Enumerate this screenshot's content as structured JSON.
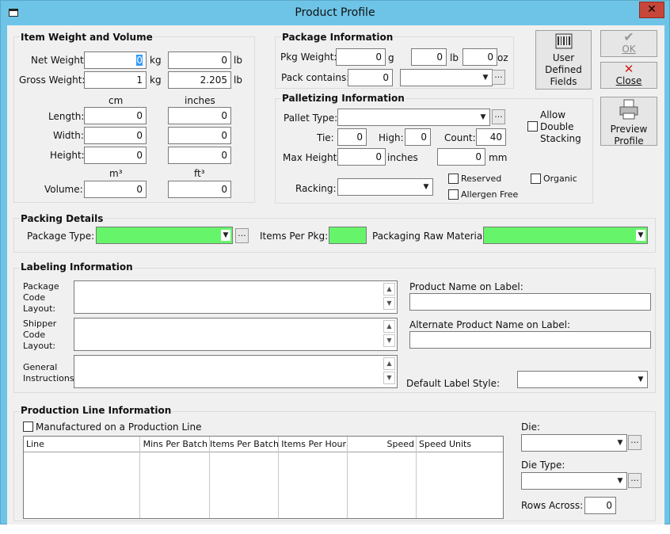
{
  "window": {
    "title": "Product Profile",
    "close_glyph": "✕"
  },
  "weight_volume": {
    "title": "Item Weight and Volume",
    "net_weight_label": "Net Weight:",
    "net_weight_kg": "0",
    "kg1": "kg",
    "net_weight_lb": "0",
    "lb1": "lb",
    "gross_weight_label": "Gross Weight:",
    "gross_weight_kg": "1",
    "kg2": "kg",
    "gross_weight_lb": "2.205",
    "lb2": "lb",
    "cm_label": "cm",
    "inches_label": "inches",
    "length_label": "Length:",
    "length_cm": "0",
    "length_in": "0",
    "width_label": "Width:",
    "width_cm": "0",
    "width_in": "0",
    "height_label": "Height:",
    "height_cm": "0",
    "height_in": "0",
    "m3_label": "m³",
    "ft3_label": "ft³",
    "volume_label": "Volume:",
    "volume_m3": "0",
    "volume_ft3": "0"
  },
  "package_info": {
    "title": "Package Information",
    "pkg_weight_label": "Pkg Weight:",
    "pkg_weight_g": "0",
    "g_label": "g",
    "pkg_weight_lb": "0",
    "lb_label": "lb",
    "pkg_weight_oz": "0",
    "oz_label": "oz",
    "pack_contains_label": "Pack contains:",
    "pack_contains_value": "0",
    "pack_contains_unit": ""
  },
  "palletizing": {
    "title": "Palletizing Information",
    "pallet_type_label": "Pallet Type:",
    "pallet_type_value": "",
    "allow_double_stacking": "Allow Double Stacking",
    "allow_line1": "Allow",
    "allow_line2": "Double",
    "allow_line3": "Stacking",
    "tie_label": "Tie:",
    "tie_value": "0",
    "high_label": "High:",
    "high_value": "0",
    "count_label": "Count:",
    "count_value": "40",
    "max_height_label": "Max Height:",
    "max_height_in": "0",
    "inches_label": "inches",
    "max_height_mm": "0",
    "mm_label": "mm",
    "reserved_label": "Reserved",
    "organic_label": "Organic",
    "racking_label": "Racking:",
    "racking_value": "",
    "allergen_free_label": "Allergen Free"
  },
  "side_buttons": {
    "udf_line1": "User",
    "udf_line2": "Defined",
    "udf_line3": "Fields",
    "ok_label": "OK",
    "close_label": "Close",
    "preview_line1": "Preview",
    "preview_line2": "Profile"
  },
  "packing": {
    "title": "Packing Details",
    "package_type_label": "Package Type:",
    "package_type_value": "",
    "items_per_pkg_label": "Items Per Pkg:",
    "items_per_pkg_value": "",
    "raw_material_label": "Packaging Raw Material:",
    "raw_material_value": ""
  },
  "labeling": {
    "title": "Labeling Information",
    "package_code_l1": "Package",
    "package_code_l2": "Code",
    "package_code_l3": "Layout:",
    "shipper_code_l1": "Shipper",
    "shipper_code_l2": "Code",
    "shipper_code_l3": "Layout:",
    "general_l1": "General",
    "general_l2": "Instructions:",
    "product_name_label": "Product Name on Label:",
    "product_name_value": "",
    "alt_product_name_label": "Alternate Product Name on Label:",
    "alt_product_name_value": "",
    "default_style_label": "Default Label Style:",
    "default_style_value": ""
  },
  "production": {
    "title": "Production Line Information",
    "manufactured_label": "Manufactured on a Production Line",
    "columns": [
      "Line",
      "Mins Per Batch",
      "Items Per Batch",
      "Items Per Hour",
      "Speed",
      "Speed Units"
    ],
    "die_label": "Die:",
    "die_value": "",
    "die_type_label": "Die Type:",
    "die_type_value": "",
    "rows_across_label": "Rows Across:",
    "rows_across_value": "0"
  }
}
